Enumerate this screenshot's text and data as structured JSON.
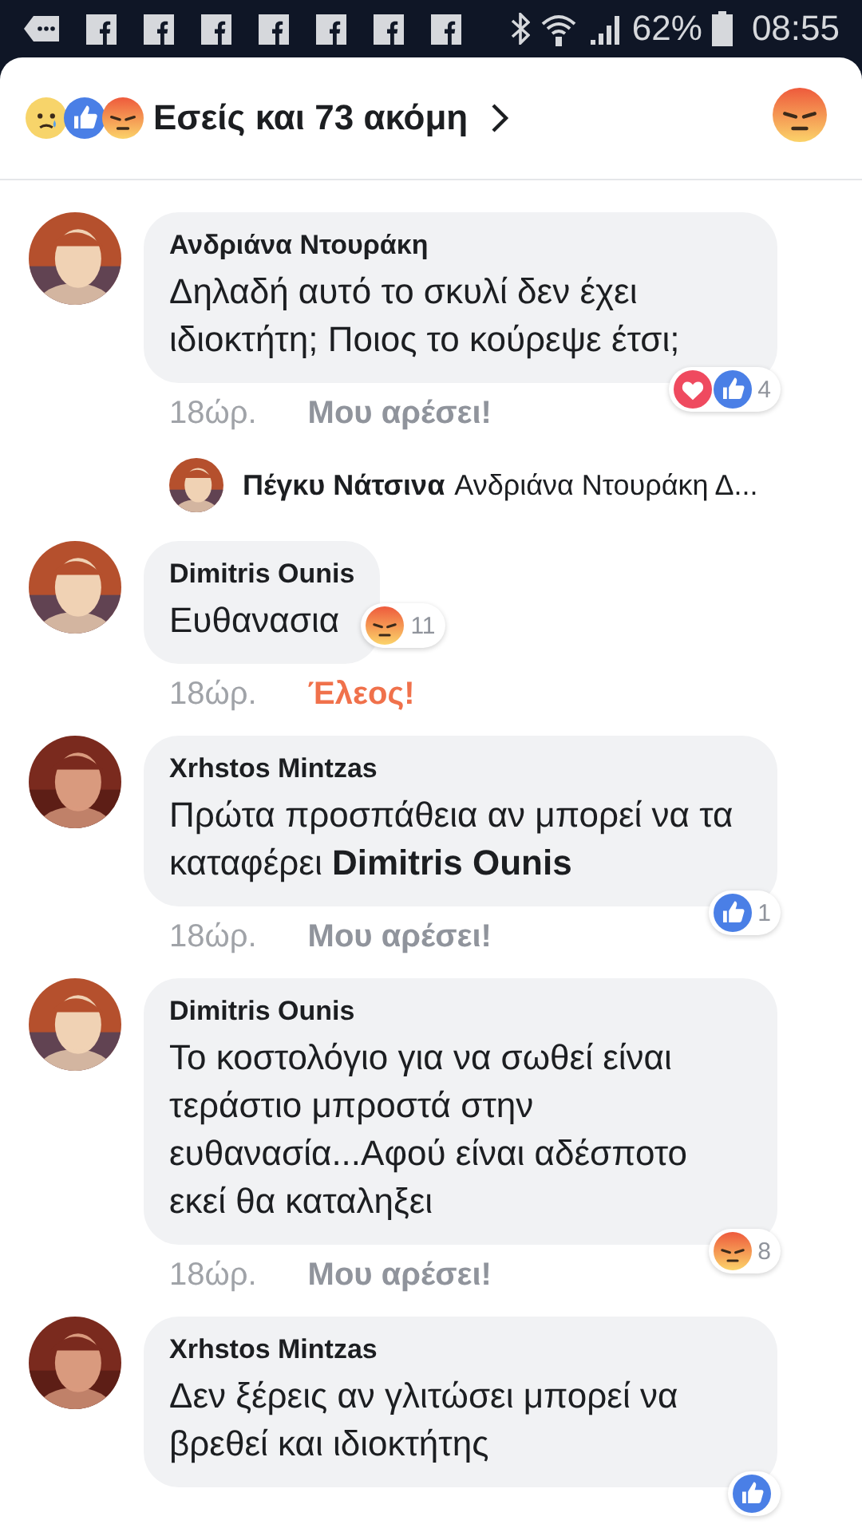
{
  "status_bar": {
    "notifications": [
      {
        "kind": "more"
      },
      {
        "kind": "facebook"
      },
      {
        "kind": "facebook"
      },
      {
        "kind": "facebook"
      },
      {
        "kind": "facebook"
      },
      {
        "kind": "facebook"
      },
      {
        "kind": "facebook"
      },
      {
        "kind": "facebook"
      }
    ],
    "battery": "62%",
    "time": "08:55"
  },
  "header": {
    "reactions": [
      {
        "kind": "sad"
      },
      {
        "kind": "like"
      },
      {
        "kind": "angry"
      }
    ],
    "summary": "Εσείς και 73 ακόμη",
    "my_reaction": {
      "kind": "angry"
    }
  },
  "comments": [
    {
      "author": "Ανδριάνα Ντουράκη",
      "text": "Δηλαδή αυτό το σκυλί δεν έχει ιδιοκτήτη; Ποιος το κούρεψε έτσι;",
      "time": "18ώρ.",
      "action": {
        "label": "Μου αρέσει!",
        "kind": "plain"
      },
      "reactions": {
        "icons": [
          {
            "kind": "love"
          },
          {
            "kind": "like"
          }
        ],
        "count": "4"
      },
      "reply": {
        "author": "Πέγκυ Νάτσινα",
        "text": "Ανδριάνα Ντουράκη Δ..."
      }
    },
    {
      "author": "Dimitris Ounis",
      "text": "Ευθανασια",
      "time": "18ώρ.",
      "action": {
        "label": "Έλεος!",
        "kind": "angry"
      },
      "reactions": {
        "icons": [
          {
            "kind": "angry"
          }
        ],
        "count": "11"
      }
    },
    {
      "author": "Xrhstos Mintzas",
      "text": "Πρώτα προσπάθεια αν μπορεί να τα καταφέρει **Dimitris Ounis**",
      "time": "18ώρ.",
      "action": {
        "label": "Μου αρέσει!",
        "kind": "plain"
      },
      "reactions": {
        "icons": [
          {
            "kind": "like"
          }
        ],
        "count": "1"
      }
    },
    {
      "author": "Dimitris Ounis",
      "text": "Το κοστολόγιο για να σωθεί είναι τεράστιο μπροστά στην ευθανασία...Αφού είναι αδέσποτο εκεί θα καταληξει",
      "time": "18ώρ.",
      "action": {
        "label": "Μου αρέσει!",
        "kind": "plain"
      },
      "reactions": {
        "icons": [
          {
            "kind": "angry"
          }
        ],
        "count": "8"
      }
    },
    {
      "author": "Xrhstos Mintzas",
      "text": "Δεν ξέρεις αν γλιτώσει μπορεί να βρεθεί και ιδιοκτήτης",
      "reactions": {
        "icons": [
          {
            "kind": "like"
          }
        ]
      }
    }
  ]
}
